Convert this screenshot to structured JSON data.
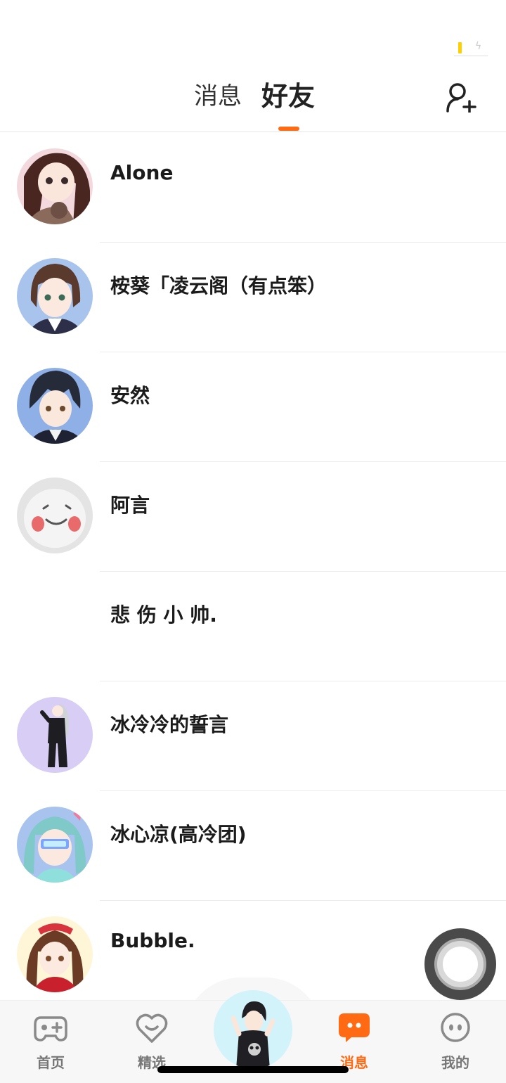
{
  "header": {
    "tabs": [
      {
        "label": "消息",
        "active": false
      },
      {
        "label": "好友",
        "active": true
      }
    ],
    "accent_color": "#ff6a13",
    "add_friend_icon": "add-user-icon"
  },
  "friends": [
    {
      "name": "Alone",
      "avatar_color": "#f3d9dd",
      "has_avatar": true
    },
    {
      "name": "桉葵「凌云阁（有点笨）",
      "avatar_color": "#a9c4ec",
      "has_avatar": true
    },
    {
      "name": "安然",
      "avatar_color": "#8fb0e6",
      "has_avatar": true
    },
    {
      "name": "阿言",
      "avatar_color": "#e4e4e4",
      "has_avatar": true
    },
    {
      "name": "悲 伤 小 帅.",
      "avatar_color": "#ffffff",
      "has_avatar": false
    },
    {
      "name": "冰冷冷的誓言",
      "avatar_color": "#d8cdf4",
      "has_avatar": true
    },
    {
      "name": "冰心凉(高冷团)",
      "avatar_color": "#a7c3ee",
      "has_avatar": true
    },
    {
      "name": "Bubble.",
      "avatar_color": "#fff6d8",
      "has_avatar": true
    }
  ],
  "bottom_nav": {
    "items": [
      {
        "label": "首页",
        "icon": "gamepad-icon",
        "active": false
      },
      {
        "label": "精选",
        "icon": "heart-chat-icon",
        "active": false
      },
      {
        "label": "消息",
        "icon": "message-bubble-icon",
        "active": true
      },
      {
        "label": "我的",
        "icon": "face-icon",
        "active": false
      }
    ],
    "center_avatar_color": "#d3f3fb"
  }
}
